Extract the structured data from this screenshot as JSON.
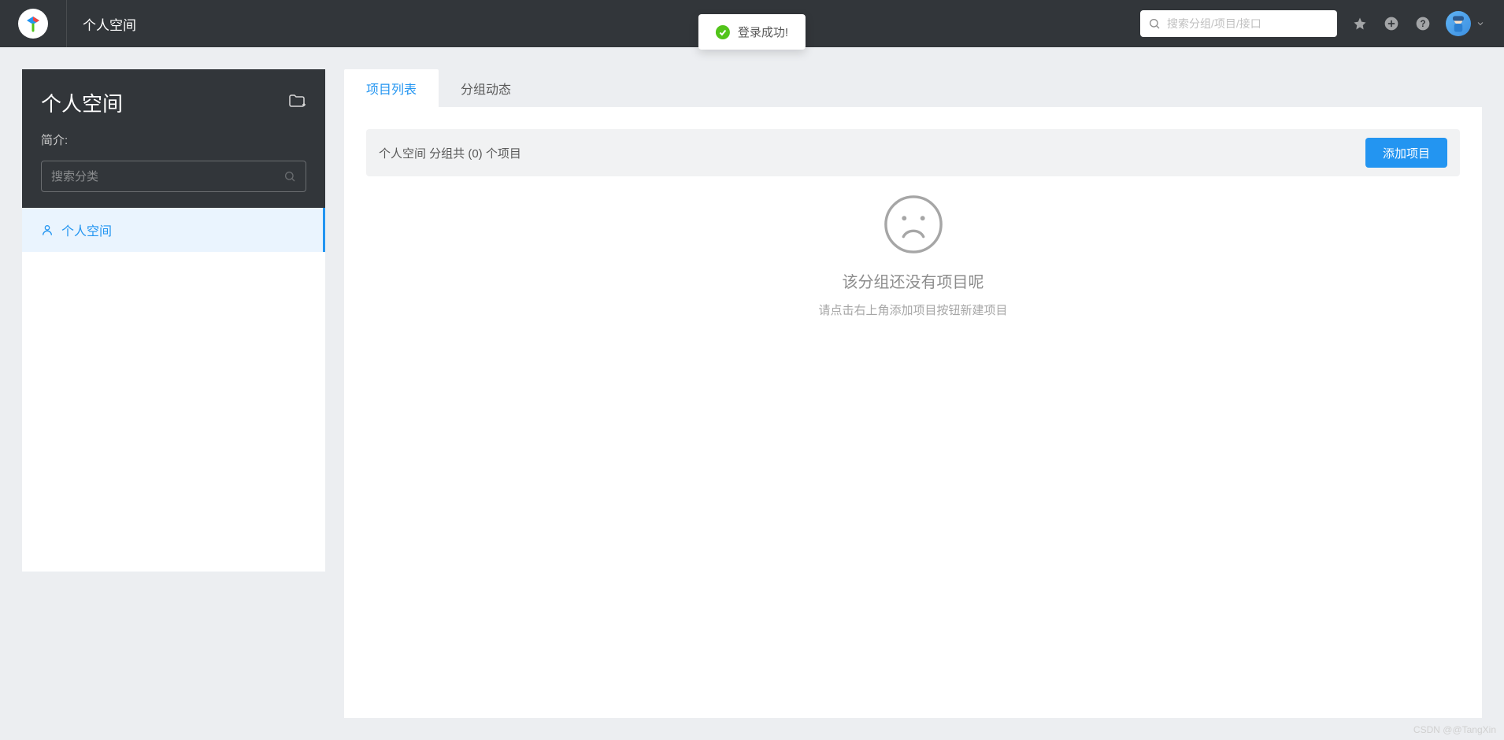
{
  "header": {
    "title": "个人空间",
    "search_placeholder": "搜索分组/项目/接口"
  },
  "toast": {
    "message": "登录成功!"
  },
  "sidebar": {
    "title": "个人空间",
    "intro_label": "简介:",
    "search_placeholder": "搜索分类",
    "items": [
      {
        "label": "个人空间"
      }
    ]
  },
  "tabs": [
    {
      "label": "项目列表",
      "active": true
    },
    {
      "label": "分组动态",
      "active": false
    }
  ],
  "main": {
    "info_text": "个人空间 分组共 (0) 个项目",
    "add_button": "添加项目",
    "empty_title": "该分组还没有项目呢",
    "empty_subtitle": "请点击右上角添加项目按钮新建项目"
  },
  "watermark": "CSDN @@TangXin"
}
